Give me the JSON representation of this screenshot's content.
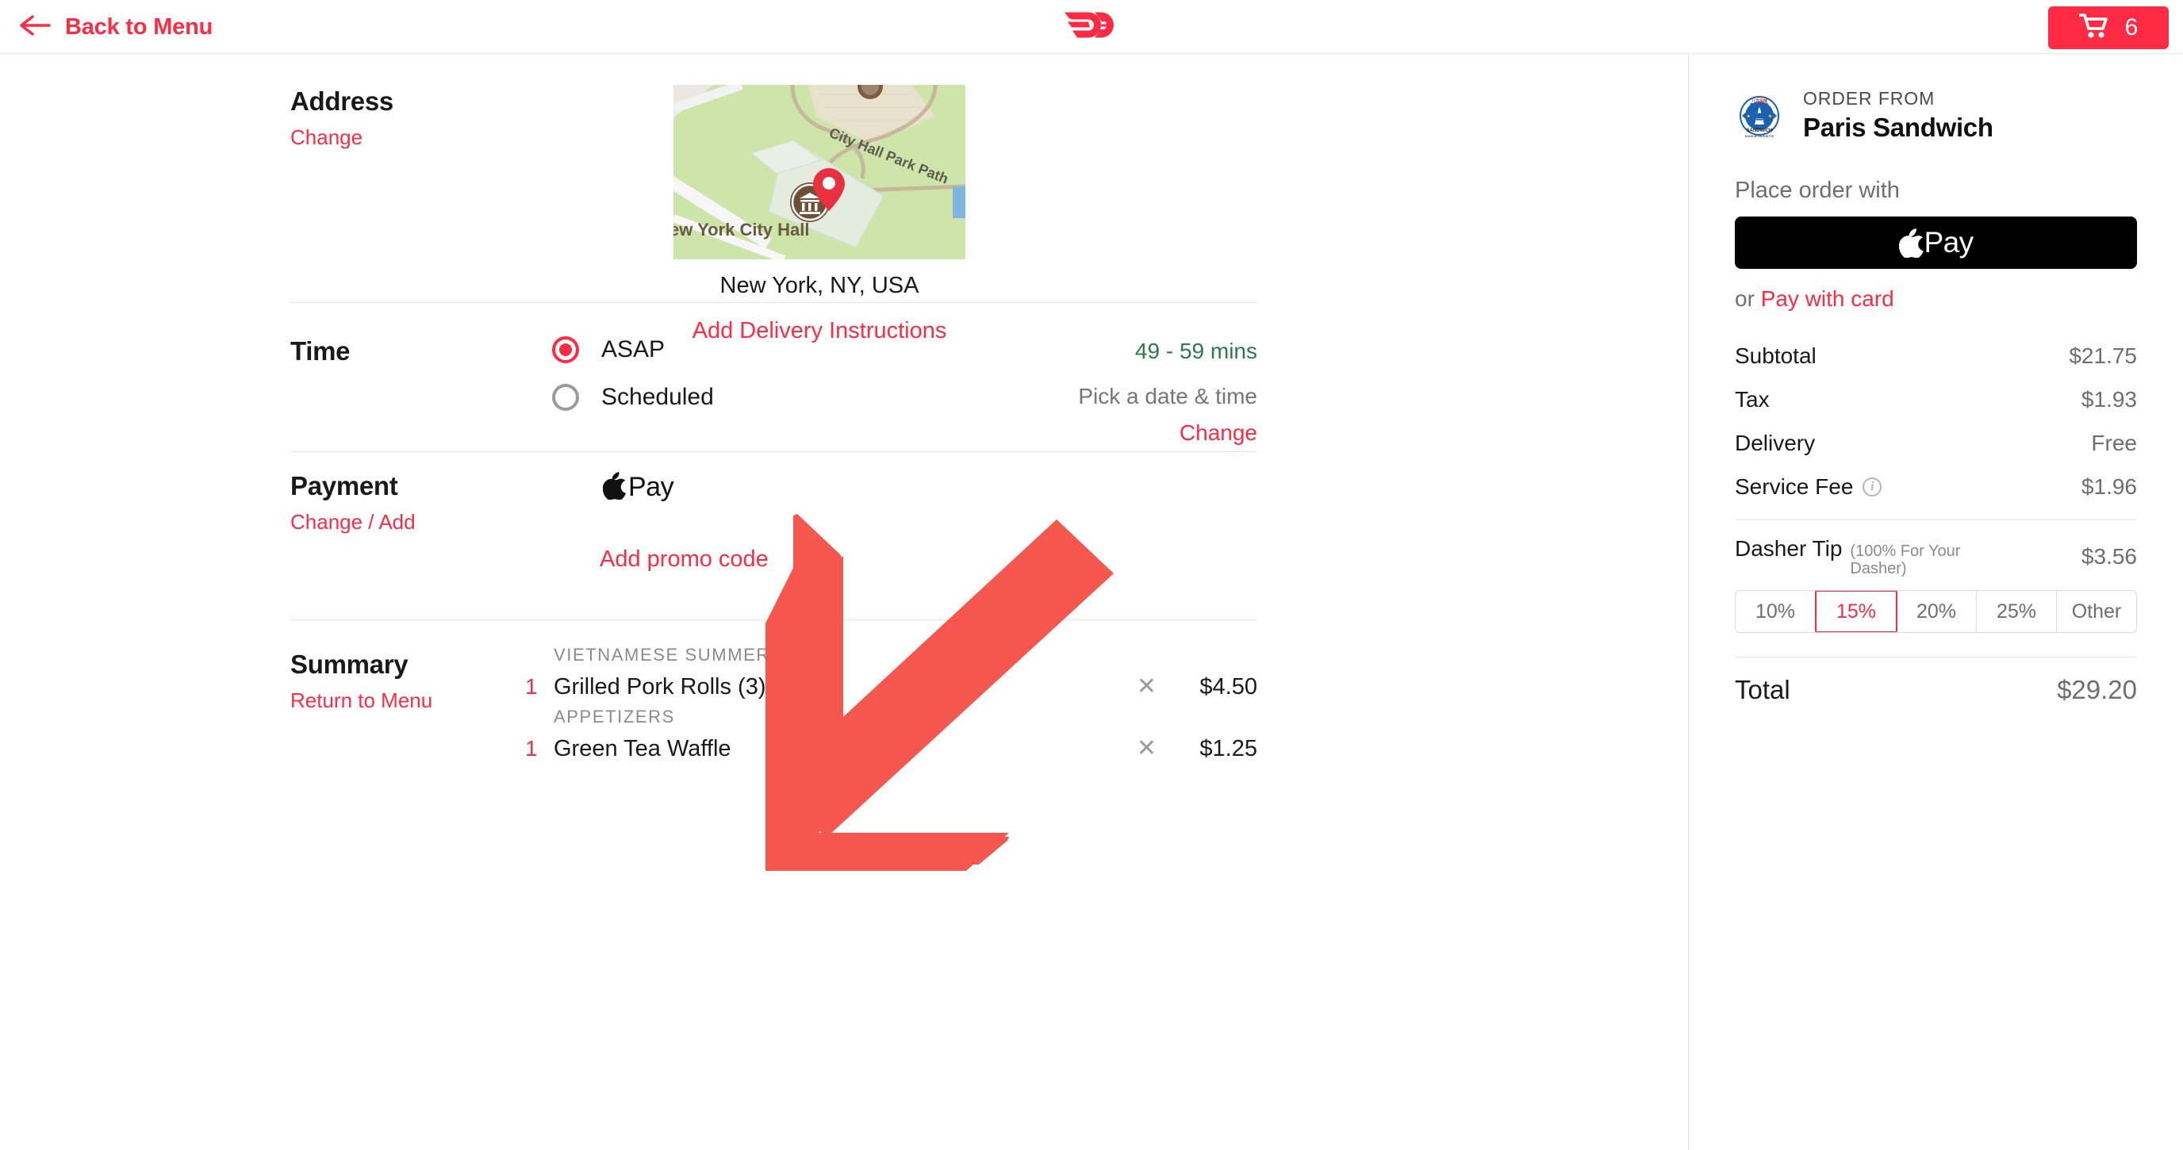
{
  "header": {
    "back_label": "Back to Menu",
    "back_icon": "arrow-left-icon",
    "brand_icon": "doordash-logo",
    "cart_icon": "shopping-cart-icon",
    "cart_count": "6",
    "accent_color": "#ff2b44"
  },
  "address": {
    "title": "Address",
    "change_label": "Change",
    "map": {
      "label_park_path": "City Hall Park Path",
      "label_city_hall": "ew York City Hall",
      "marker_icon": "map-pin-icon",
      "poi_icon": "museum-icon"
    },
    "value": "New York, NY, USA",
    "instructions_label": "Add Delivery Instructions"
  },
  "time": {
    "title": "Time",
    "options": [
      {
        "label": "ASAP",
        "selected": true
      },
      {
        "label": "Scheduled",
        "selected": false
      }
    ],
    "eta": "49 - 59 mins",
    "pick_label": "Pick a date & time",
    "change_label": "Change"
  },
  "payment": {
    "title": "Payment",
    "change_label": "Change / Add",
    "method_icon": "apple-logo-icon",
    "method_label": "Pay",
    "promo_label": "Add promo code"
  },
  "summary": {
    "title": "Summary",
    "return_label": "Return to Menu",
    "remove_icon": "close-x-icon",
    "items": [
      {
        "category": "VIETNAMESE SUMMER ROLL",
        "qty": "1",
        "name": "Grilled Pork Rolls (3)",
        "price": "$4.50"
      },
      {
        "category": "APPETIZERS",
        "qty": "1",
        "name": "Green Tea Waffle",
        "price": "$1.25"
      }
    ]
  },
  "sidebar": {
    "order_from_label": "ORDER FROM",
    "store_name": "Paris Sandwich",
    "store_logo_icon": "paris-sandwich-logo",
    "place_order_label": "Place order with",
    "apple_pay_label": "Pay",
    "apple_pay_icon": "apple-logo-icon",
    "or_label": "or",
    "pay_with_card_label": "Pay with card",
    "charges": [
      {
        "label": "Subtotal",
        "value": "$21.75",
        "info": false
      },
      {
        "label": "Tax",
        "value": "$1.93",
        "info": false
      },
      {
        "label": "Delivery",
        "value": "Free",
        "info": false
      },
      {
        "label": "Service Fee",
        "value": "$1.96",
        "info": true
      }
    ],
    "info_icon": "info-icon",
    "tip": {
      "label": "Dasher Tip",
      "note": "(100% For Your Dasher)",
      "value": "$3.56",
      "options": [
        "10%",
        "15%",
        "20%",
        "25%",
        "Other"
      ],
      "selected": "15%"
    },
    "total": {
      "label": "Total",
      "value": "$29.20"
    }
  },
  "overlay": {
    "arrow_icon": "pointer-arrow-icon",
    "arrow_color": "#f5574f"
  }
}
